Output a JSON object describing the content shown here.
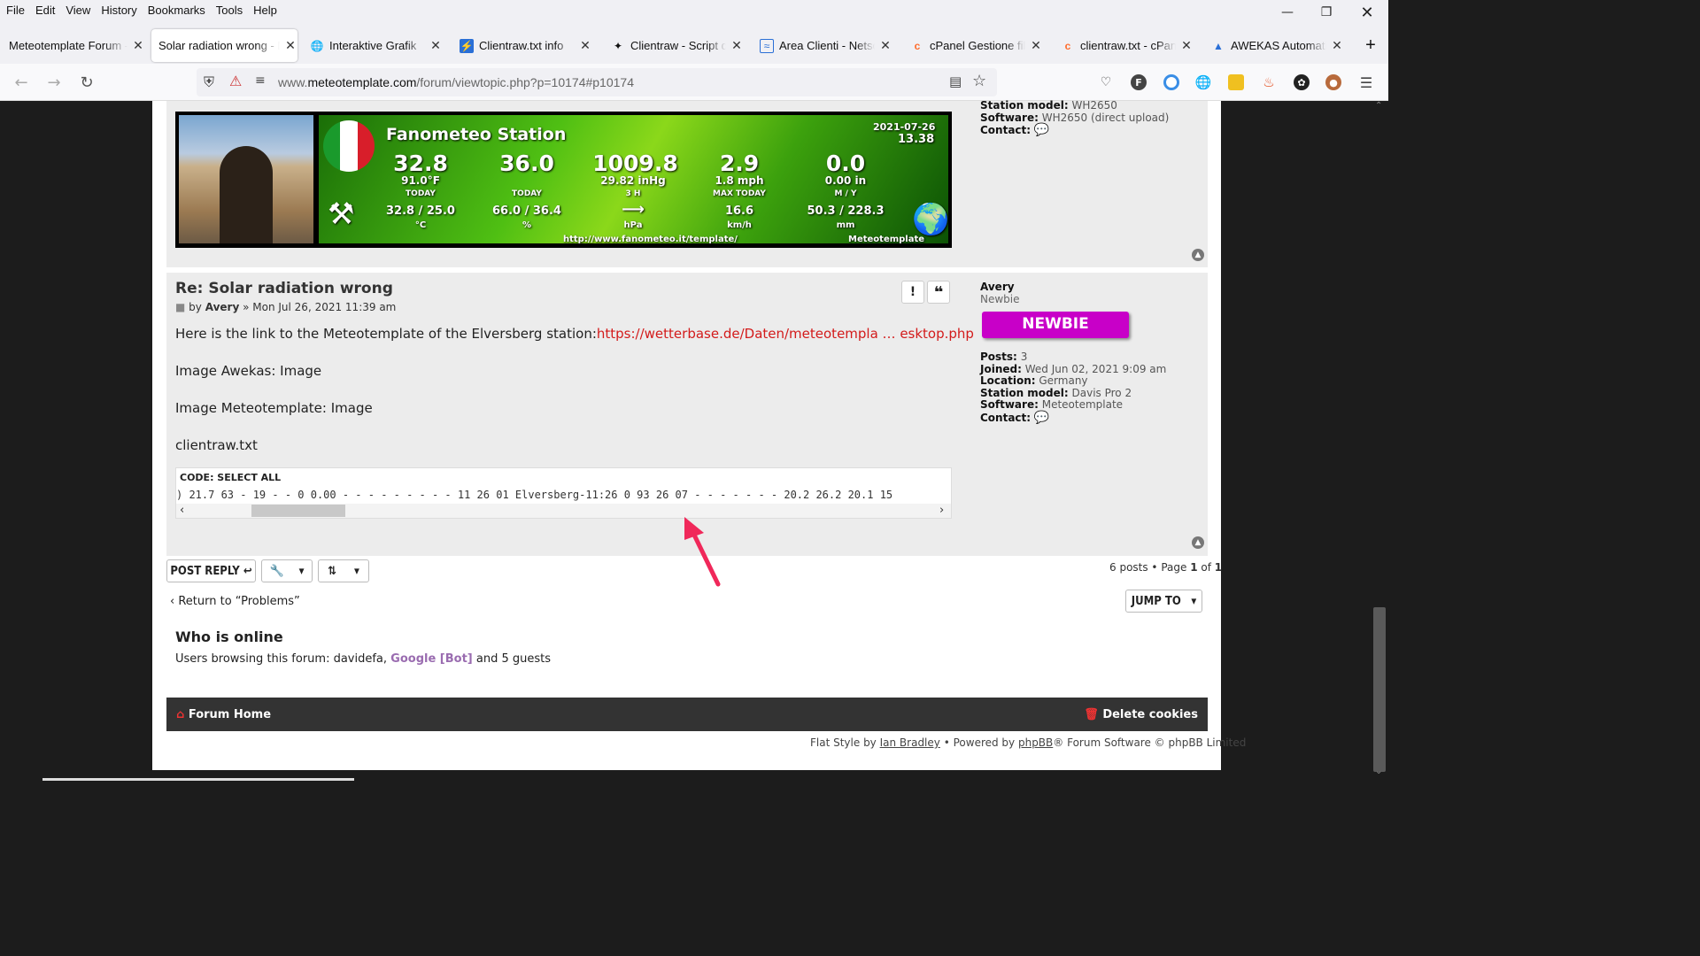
{
  "menu": [
    "File",
    "Edit",
    "View",
    "History",
    "Bookmarks",
    "Tools",
    "Help"
  ],
  "tabs": [
    {
      "label": "Meteotemplate Forum - ",
      "icon": "page-icon",
      "active": false
    },
    {
      "label": "Solar radiation wrong - M",
      "icon": "none",
      "active": true
    },
    {
      "label": "Interaktive Grafik",
      "icon": "globe-icon",
      "active": false
    },
    {
      "label": "Clientraw.txt info",
      "icon": "lightning-icon",
      "active": false
    },
    {
      "label": "Clientraw - Script de",
      "icon": "bird-icon",
      "active": false
    },
    {
      "label": "Area Clienti - Netson",
      "icon": "wave-icon",
      "active": false
    },
    {
      "label": "cPanel Gestione file",
      "icon": "cpanel-icon",
      "active": false
    },
    {
      "label": "clientraw.txt - cPanel",
      "icon": "cpanel-icon",
      "active": false
    },
    {
      "label": "AWEKAS Automatic",
      "icon": "awekas-icon",
      "active": false
    }
  ],
  "url": {
    "prefix": "www.",
    "domain": "meteotemplate.com",
    "path": "/forum/viewtopic.php?p=10174#p10174"
  },
  "banner": {
    "station": "Fanometeo Station",
    "date": "2021-07-26",
    "time": "13.38",
    "temp": "32.8",
    "temp_f": "91.0°F",
    "temp_lbl": "TODAY",
    "temp_range": "32.8 / 25.0",
    "temp_unit": "°C",
    "hum": "36.0",
    "hum_lbl": "TODAY",
    "hum_range": "66.0 / 36.4",
    "hum_unit": "%",
    "press": "1009.8",
    "press_hg": "29.82 inHg",
    "press_lbl": "3 H",
    "press_arrow": "⟶",
    "press_unit": "hPa",
    "wind": "2.9",
    "wind_mph": "1.8 mph",
    "wind_lbl": "MAX TODAY",
    "wind_max": "16.6",
    "wind_unit": "km/h",
    "rain": "0.0",
    "rain_in": "0.00 in",
    "rain_lbl": "M / Y",
    "rain_my": "50.3 / 228.3",
    "rain_unit": "mm",
    "site": "http://www.fanometeo.it/template/",
    "brand": "Meteotemplate"
  },
  "prev_profile": {
    "station_model_lbl": "Station model:",
    "station_model": "WH2650",
    "software_lbl": "Software:",
    "software": "WH2650 (direct upload)",
    "contact_lbl": "Contact:"
  },
  "post": {
    "title": "Re: Solar radiation wrong",
    "by": "by",
    "author": "Avery",
    "date": "» Mon Jul 26, 2021 11:39 am",
    "line1_text": "Here is the link to the Meteotemplate of the Elversberg station:",
    "line1_link": "https://wetterbase.de/Daten/meteotempla … esktop.php",
    "line2": "Image Awekas: ",
    "line2_img": "Image",
    "line3": "Image Meteotemplate: ",
    "line3_img": "Image",
    "line4": "clientraw.txt",
    "code_header": "CODE: SELECT ALL",
    "code": ") 21.7 63 - 19 - - 0 0.00 - - - - - - - - - 11 26 01 Elversberg-11:26 0 93 26 07 - - - - - - - 20.2 26.2 20.1 15"
  },
  "profile": {
    "name": "Avery",
    "rank": "Newbie",
    "badge": "NEWBIE",
    "posts_lbl": "Posts:",
    "posts": "3",
    "joined_lbl": "Joined:",
    "joined": "Wed Jun 02, 2021 9:09 am",
    "location_lbl": "Location:",
    "location": "Germany",
    "station_model_lbl": "Station model:",
    "station_model": "Davis Pro 2",
    "software_lbl": "Software:",
    "software": "Meteotemplate",
    "contact_lbl": "Contact:"
  },
  "actions": {
    "post_reply": "POST REPLY",
    "pagination": "6 posts • Page ",
    "page_cur": "1",
    "page_of": " of ",
    "page_total": "1",
    "return": "Return to “Problems”",
    "jump_to": "JUMP TO"
  },
  "online": {
    "title": "Who is online",
    "text": "Users browsing this forum: davidefa, ",
    "bot": "Google [Bot]",
    "tail": " and 5 guests"
  },
  "footer": {
    "home": "Forum Home",
    "delete": "Delete cookies",
    "credit_pre": "Flat Style by ",
    "credit_author": "Ian Bradley",
    "credit_mid": " • Powered by ",
    "credit_phpbb": "phpBB",
    "credit_tail": "® Forum Software © phpBB Limited"
  },
  "colors": {
    "accent": "#cc0000",
    "badge": "#c800c8",
    "link_purple": "#9a6cb0",
    "arrow": "#f0285a"
  }
}
